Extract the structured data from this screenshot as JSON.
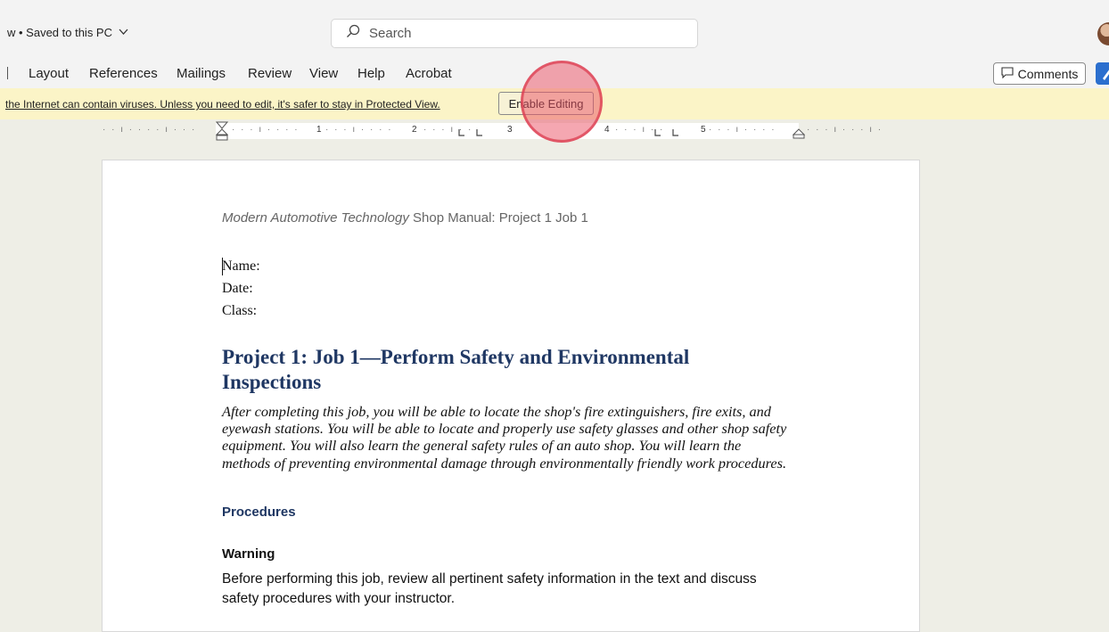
{
  "titlebar": {
    "status": "w • Saved to this PC",
    "search_placeholder": "Search"
  },
  "ribbon": {
    "tabs": [
      "Layout",
      "References",
      "Mailings",
      "Review",
      "View",
      "Help",
      "Acrobat"
    ],
    "comments_label": "Comments"
  },
  "protected_view": {
    "message": "the Internet can contain viruses. Unless you need to edit, it's safer to stay in Protected View.",
    "enable_editing_label": "Enable Editing"
  },
  "ruler": {
    "numbers": [
      "1",
      "2",
      "3",
      "4",
      "5"
    ]
  },
  "document": {
    "header_italic": "Modern Automotive Technology",
    "header_rest": " Shop Manual: Project 1 Job 1",
    "fields": [
      "Name:",
      "Date:",
      "Class:"
    ],
    "title": "Project 1: Job 1—Perform Safety and Environmental Inspections",
    "intro": "After completing this job, you will be able to locate the shop's fire extinguishers, fire exits, and eyewash stations. You will be able to locate and properly use safety glasses and other shop safety equipment. You will also learn the general safety rules of an auto shop. You will learn the methods of preventing environmental damage through environmentally friendly work procedures.",
    "procedures_heading": "Procedures",
    "warning_heading": "Warning",
    "warning_text": "Before performing this job, review all pertinent safety information in the text and discuss safety procedures with your instructor."
  },
  "colors": {
    "heading_blue": "#1f3763",
    "message_bar": "#fbf4c7",
    "highlight": "#eb5064"
  }
}
